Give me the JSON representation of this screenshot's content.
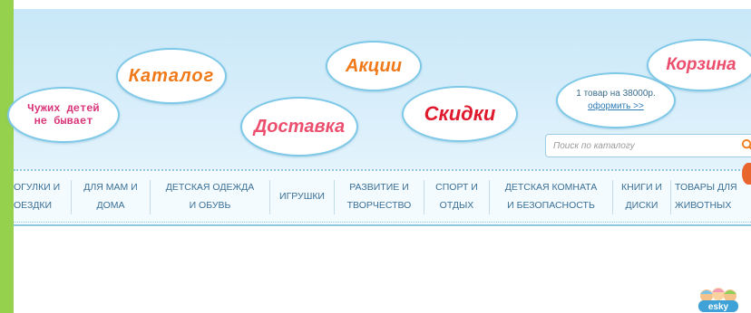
{
  "slogan": "Чужих детей\nне бывает",
  "clouds": {
    "catalog": "Каталог",
    "delivery": "Доставка",
    "actions": "Акции",
    "discounts": "Скидки",
    "cart": "Корзина"
  },
  "cart_summary": {
    "info": "1 товар на 38000р.",
    "checkout_link": "оформить >>"
  },
  "search": {
    "placeholder": "Поиск по каталогу"
  },
  "nav": [
    "ОГУЛКИ И\nОЕЗДКИ",
    "ДЛЯ МАМ И\nДОМА",
    "ДЕТСКАЯ ОДЕЖДА\nИ ОБУВЬ",
    "ИГРУШКИ",
    "РАЗВИТИЕ И\nТВОРЧЕСТВО",
    "СПОРТ И\nОТДЫХ",
    "ДЕТСКАЯ КОМНАТА\nИ БЕЗОПАСНОСТЬ",
    "КНИГИ И\nДИСКИ",
    "ТОВАРЫ ДЛЯ\nЖИВОТНЫХ"
  ],
  "logo_text": "esky",
  "colors": {
    "accent_green": "#95d14c",
    "cloud_border": "#7ec8e8",
    "nav_text": "#3a6f96",
    "search_icon": "#f07a1a"
  }
}
